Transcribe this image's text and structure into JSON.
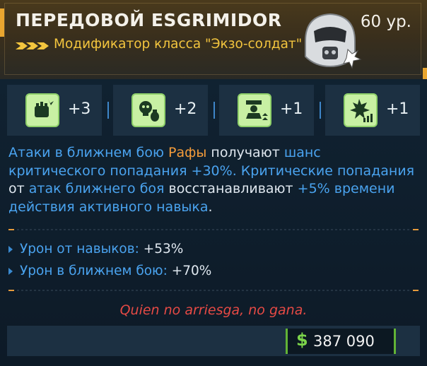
{
  "mod": {
    "name": "ПЕРЕДОВОЙ ESGRIMIDOR",
    "level": "60 ур.",
    "class_modifier": "Модификатор класса \"Экзо-солдат\""
  },
  "stats": [
    {
      "icon": "fist-burst-icon",
      "value": "+3"
    },
    {
      "icon": "skull-grenade-icon",
      "value": "+2"
    },
    {
      "icon": "soldier-rank-icon",
      "value": "+1"
    },
    {
      "icon": "explosion-arrows-icon",
      "value": "+1"
    }
  ],
  "description": {
    "p1": "Атаки в ближнем бою ",
    "p2": "Рафы",
    "p3": " получают ",
    "p4": "шанс критического попадания +30%",
    "p5": ". Критические попадания ",
    "p6": "от",
    "p7": " атак ближнего боя ",
    "p8": "восстанавливают",
    "p9": " +5% времени действия активного навыка",
    "p10": "."
  },
  "bonuses": [
    {
      "label": "Урон от навыков:",
      "value": "+53%"
    },
    {
      "label": "Урон в ближнем бою:",
      "value": "+70%"
    }
  ],
  "flavor_text": "Quien no arriesga, no gana.",
  "price": {
    "currency_symbol": "$",
    "amount": "387 090"
  },
  "colors": {
    "accent": "#f3c53e",
    "keyword": "#4aa3ef",
    "highlight": "#f39b3a",
    "flavor": "#e64a45",
    "money": "#7bd44a"
  }
}
